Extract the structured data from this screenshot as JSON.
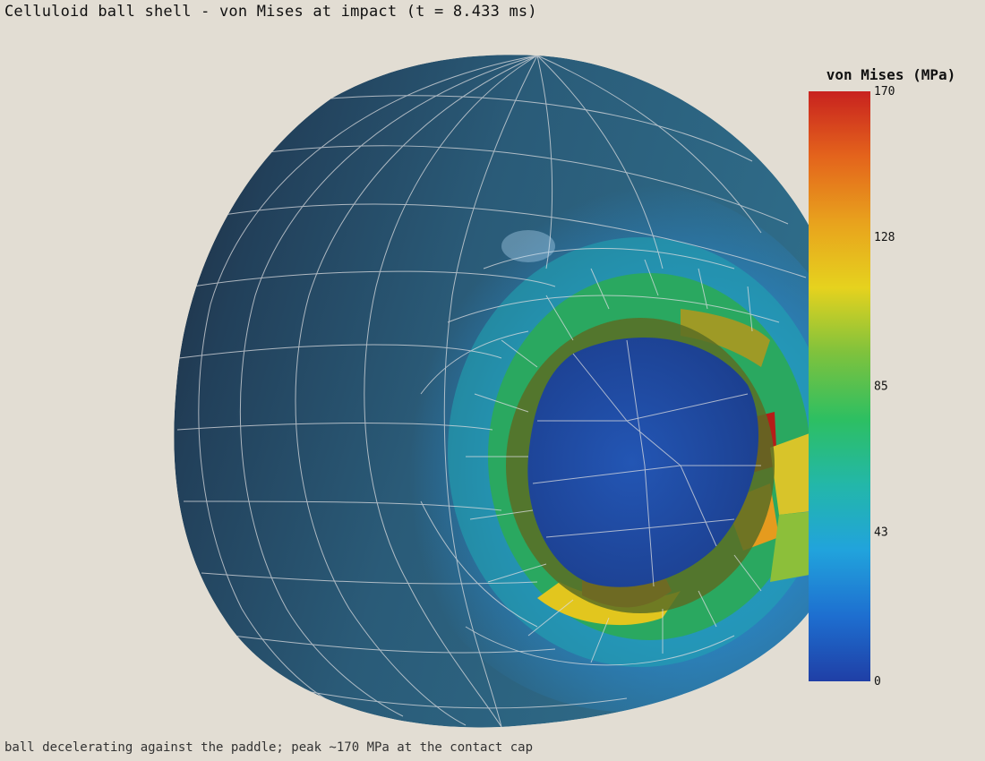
{
  "title": "Celluloid ball shell - von Mises at impact (t = 8.433 ms)",
  "footer": "ball decelerating against the paddle; peak ~170 MPa at the contact cap",
  "colorbar": {
    "title": "von Mises (MPa)",
    "min": 0,
    "max": 170,
    "ticks": [
      "0",
      "43",
      "85",
      "128",
      "170"
    ],
    "colorscale": [
      "#1f3fa6",
      "#1e6fd0",
      "#21a3dc",
      "#23b7a9",
      "#2dbf62",
      "#7ec23d",
      "#e6d21e",
      "#e8a21d",
      "#e4641c",
      "#c8221f"
    ]
  },
  "colors": {
    "background": "#e2ddd3",
    "shell_low": "#2b5775",
    "mesh_line": "#dcdde0"
  }
}
